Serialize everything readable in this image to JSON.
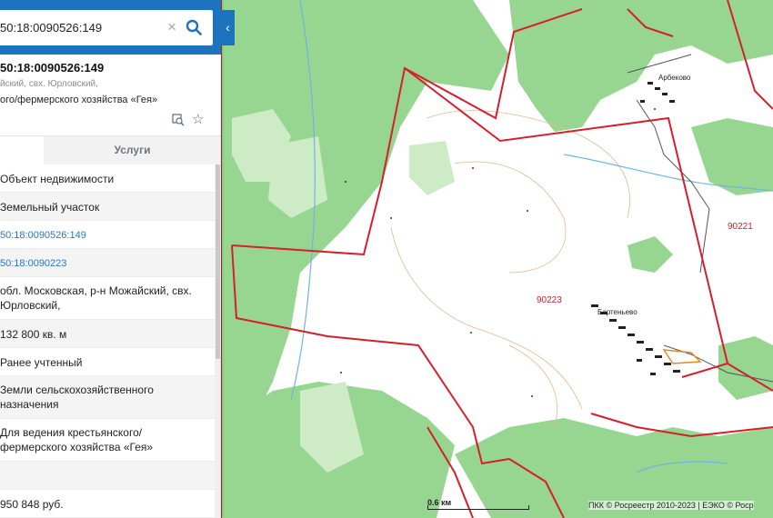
{
  "search": {
    "query": "50:18:0090526:149"
  },
  "parcel": {
    "number": "50:18:0090526:149",
    "address_short": "йский, свх. Юрловский,",
    "purpose_short": "ого/фермерского хозяйства «Гея»"
  },
  "tabs": {
    "services": "Услуги"
  },
  "rows": [
    {
      "text": "Объект недвижимости",
      "link": false
    },
    {
      "text": "Земельный участок",
      "link": false
    },
    {
      "text": "50:18:0090526:149",
      "link": true
    },
    {
      "text": "50:18:0090223",
      "link": true
    },
    {
      "text": "обл. Московская, р-н Можайский, свх.",
      "text2": "Юрловский,",
      "link": false
    },
    {
      "text": "132 800 кв. м",
      "link": false
    },
    {
      "text": "Ранее учтенный",
      "link": false
    },
    {
      "text": "Земли сельскохозяйственного",
      "text2": "назначения",
      "link": false
    },
    {
      "text": "Для ведения крестьянского/",
      "text2": "фермерского хозяйства «Гея»",
      "link": false
    },
    {
      "text": "",
      "link": false
    },
    {
      "text": "950 848 руб.",
      "link": false
    }
  ],
  "map": {
    "quarters": [
      "90223",
      "90221"
    ],
    "villages": [
      "Арбеково",
      "Бартеньево"
    ],
    "scale_label": "0.6 км",
    "attribution": "ПКК © Росреестр 2010-2023 | ЕЭКО © Роср"
  },
  "colors": {
    "accent": "#1e73be",
    "forest": "#93d48c",
    "boundary": "#d51f2b",
    "link": "#2478c8"
  }
}
